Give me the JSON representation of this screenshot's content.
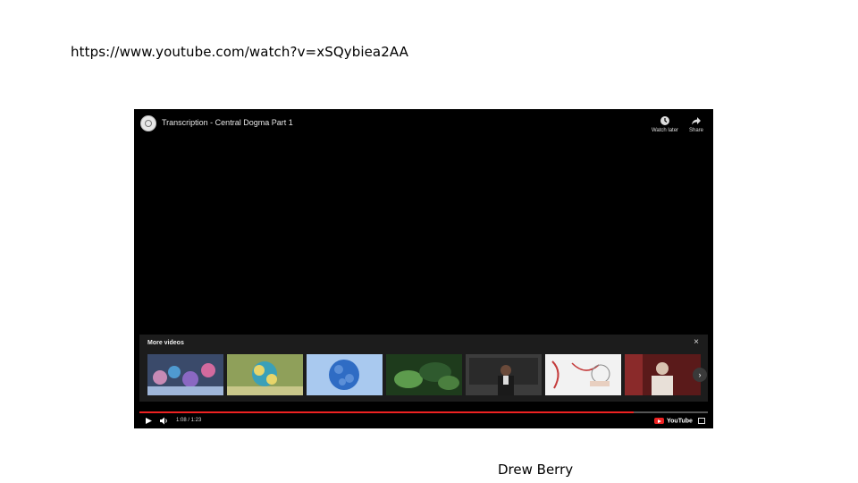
{
  "slide": {
    "url_text": "https://www.youtube.com/watch?v=xSQybiea2AA",
    "credit": "Drew Berry"
  },
  "player": {
    "title": "Transcription - Central Dogma Part 1",
    "watch_later_label": "Watch later",
    "share_label": "Share",
    "more_videos_label": "More videos",
    "close_icon": "×",
    "time_display": "1:08 / 1:23",
    "progress": 0.87,
    "logo_text": "YouTube",
    "thumbnails": [
      {
        "name": "thumb-proteins",
        "colors": [
          "#3a4a6a",
          "#c78ab5",
          "#4f9ad0"
        ]
      },
      {
        "name": "thumb-yellow-molecule",
        "colors": [
          "#8fa05a",
          "#e8d56a",
          "#3aa0b8"
        ]
      },
      {
        "name": "thumb-blue-virus",
        "colors": [
          "#5b8fd8",
          "#2f6cc4",
          "#a9c9ef"
        ]
      },
      {
        "name": "thumb-green-fibers",
        "colors": [
          "#2f5a2e",
          "#5d9b4d",
          "#1e3b1c"
        ]
      },
      {
        "name": "thumb-lecturer-chalkboard",
        "colors": [
          "#3c3c3c",
          "#6a6a6a",
          "#2a2a2a"
        ]
      },
      {
        "name": "thumb-drawing-diagram",
        "colors": [
          "#f2f2f2",
          "#c43a3a",
          "#dcdcdc"
        ]
      },
      {
        "name": "thumb-speaker",
        "colors": [
          "#5a1a1a",
          "#d8c2b0",
          "#8a2a2a"
        ]
      }
    ]
  }
}
